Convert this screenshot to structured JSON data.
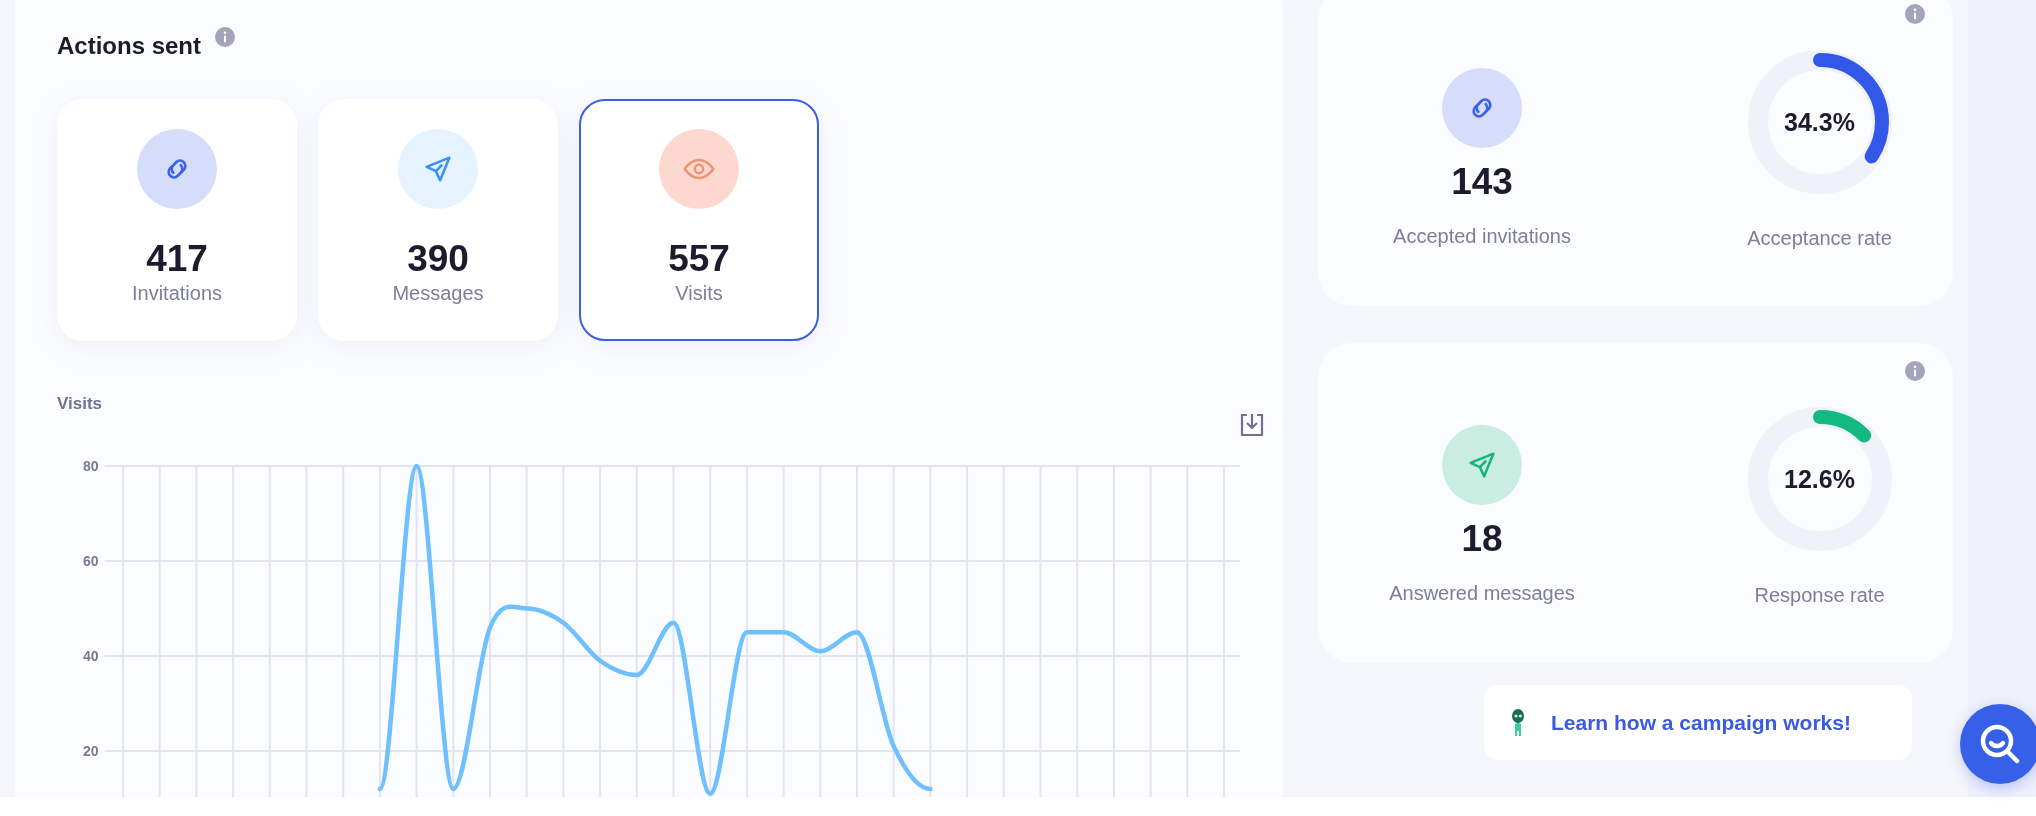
{
  "actions_sent": {
    "title": "Actions sent",
    "tiles": [
      {
        "kind": "link",
        "value": "417",
        "label": "Invitations",
        "selected": false
      },
      {
        "kind": "send",
        "value": "390",
        "label": "Messages",
        "selected": false
      },
      {
        "kind": "eye",
        "value": "557",
        "label": "Visits",
        "selected": true
      }
    ]
  },
  "visits_chart": {
    "chart_data": {
      "type": "line",
      "title": "Visits",
      "grid": true,
      "categories": [
        null,
        null,
        null,
        null,
        null,
        null,
        null,
        null,
        null,
        null,
        null,
        null,
        null,
        null,
        null,
        null,
        null,
        null,
        null,
        null,
        null,
        null,
        null,
        null,
        null,
        null,
        null,
        null,
        null,
        null,
        null
      ],
      "ylim": [
        0,
        80
      ],
      "yticks": [
        20,
        40,
        60,
        80
      ],
      "series": [
        {
          "color": "#6ec0ff",
          "values": [
            null,
            null,
            null,
            null,
            null,
            null,
            null,
            12,
            80,
            12,
            46,
            50,
            47,
            39,
            36,
            47,
            11,
            45,
            45,
            41,
            45,
            21,
            12,
            null,
            null,
            null,
            null,
            null,
            null,
            null,
            null
          ]
        }
      ]
    }
  },
  "rates": [
    {
      "kind": "link",
      "value": "143",
      "label": "Accepted invitations",
      "rate": "34.3%",
      "rate_label": "Acceptance rate",
      "level": 0.343,
      "color": "#3358e8"
    },
    {
      "kind": "send",
      "value": "18",
      "label": "Answered messages",
      "rate": "12.6%",
      "rate_label": "Response rate",
      "level": 0.126,
      "color": "#12b981"
    }
  ],
  "learn_link": {
    "label": "Learn how a campaign works!"
  }
}
